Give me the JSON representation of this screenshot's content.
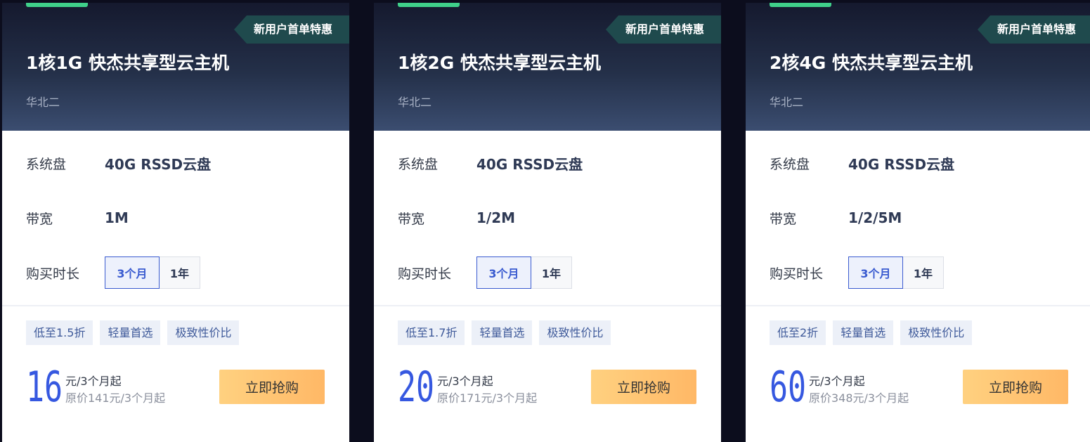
{
  "cards": [
    {
      "promo_tag": "新用户首单特惠",
      "title": "1核1G 快杰共享型云主机",
      "region": "华北二",
      "specs": [
        {
          "label": "系统盘",
          "value": "40G RSSD云盘"
        },
        {
          "label": "带宽",
          "value": "1M"
        }
      ],
      "duration_label": "购买时长",
      "duration_options": [
        "3个月",
        "1年"
      ],
      "duration_selected": "3个月",
      "tags": [
        "低至1.5折",
        "轻量首选",
        "极致性价比"
      ],
      "price": "16",
      "price_unit": "元/3个月起",
      "original_price": "原价141元/3个月起",
      "buy_label": "立即抢购"
    },
    {
      "promo_tag": "新用户首单特惠",
      "title": "1核2G 快杰共享型云主机",
      "region": "华北二",
      "specs": [
        {
          "label": "系统盘",
          "value": "40G RSSD云盘"
        },
        {
          "label": "带宽",
          "value": "1/2M"
        }
      ],
      "duration_label": "购买时长",
      "duration_options": [
        "3个月",
        "1年"
      ],
      "duration_selected": "3个月",
      "tags": [
        "低至1.7折",
        "轻量首选",
        "极致性价比"
      ],
      "price": "20",
      "price_unit": "元/3个月起",
      "original_price": "原价171元/3个月起",
      "buy_label": "立即抢购"
    },
    {
      "promo_tag": "新用户首单特惠",
      "title": "2核4G 快杰共享型云主机",
      "region": "华北二",
      "specs": [
        {
          "label": "系统盘",
          "value": "40G RSSD云盘"
        },
        {
          "label": "带宽",
          "value": "1/2/5M"
        }
      ],
      "duration_label": "购买时长",
      "duration_options": [
        "3个月",
        "1年"
      ],
      "duration_selected": "3个月",
      "tags": [
        "低至2折",
        "轻量首选",
        "极致性价比"
      ],
      "price": "60",
      "price_unit": "元/3个月起",
      "original_price": "原价348元/3个月起",
      "buy_label": "立即抢购"
    }
  ],
  "colors": {
    "page_background": "#0c0d1d",
    "accent_green": "#3fd08a",
    "price_blue": "#3658e0",
    "button_orange": "#ffb866",
    "promo_tag_bg": "#1f4a4d"
  }
}
